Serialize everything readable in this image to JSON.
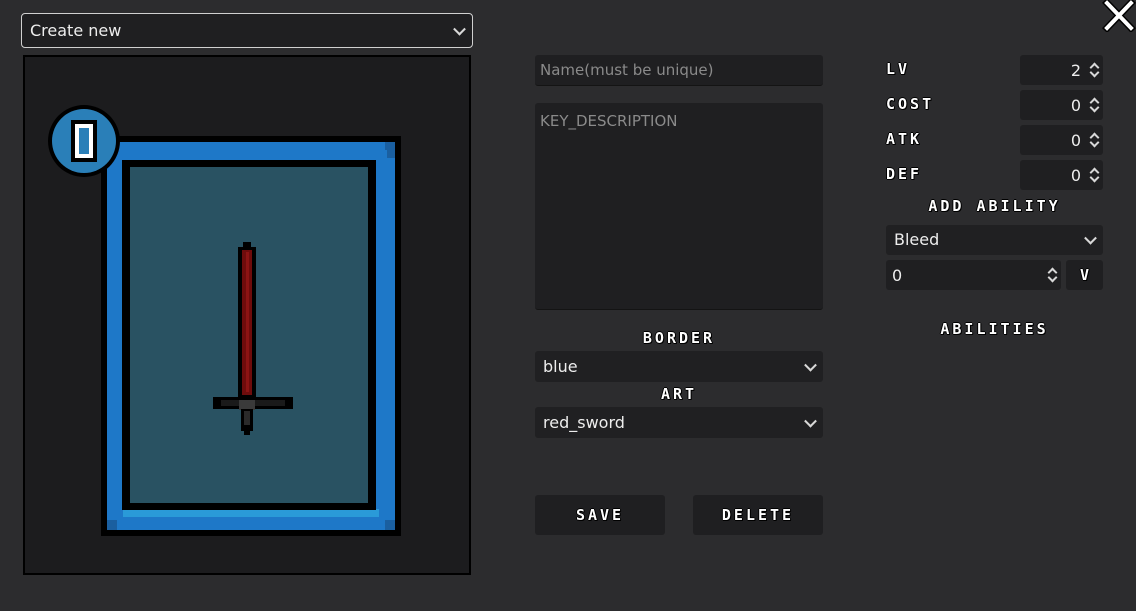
{
  "top": {
    "mode_select": "Create new"
  },
  "form": {
    "name_placeholder": "Name(must be unique)",
    "description_placeholder": "KEY_DESCRIPTION",
    "border_label": "BORDER",
    "border_value": "blue",
    "art_label": "ART",
    "art_value": "red_sword",
    "save_label": "SAVE",
    "delete_label": "DELETE"
  },
  "stats": {
    "lv_label": "LV",
    "lv_value": "2",
    "cost_label": "COST",
    "cost_value": "0",
    "atk_label": "ATK",
    "atk_value": "0",
    "def_label": "DEF",
    "def_value": "0"
  },
  "abilities": {
    "add_label": "ADD ABILITY",
    "ability_select": "Bleed",
    "ability_amount": "0",
    "add_button": "V",
    "list_label": "ABILITIES"
  },
  "card": {
    "cost_badge": "0",
    "border_color": "#1e78c8",
    "badge_color": "#2a7fb8",
    "art_bg": "#295262"
  },
  "icons": {
    "close": "close-icon",
    "sword": "red-sword-art"
  }
}
